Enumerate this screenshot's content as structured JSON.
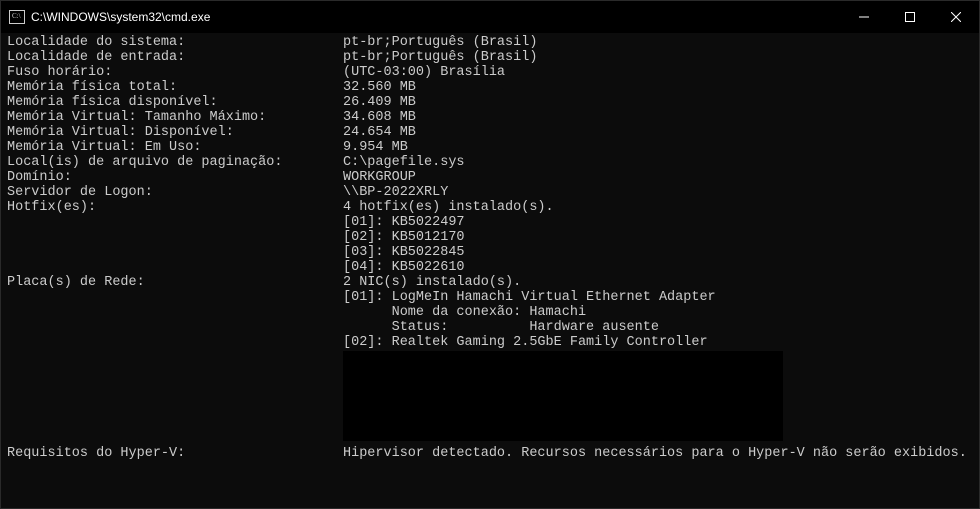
{
  "window": {
    "title": "C:\\WINDOWS\\system32\\cmd.exe"
  },
  "rows": [
    {
      "label": "Localidade do sistema:",
      "value": "pt-br;Português (Brasil)"
    },
    {
      "label": "Localidade de entrada:",
      "value": "pt-br;Português (Brasil)"
    },
    {
      "label": "Fuso horário:",
      "value": "(UTC-03:00) Brasília"
    },
    {
      "label": "Memória física total:",
      "value": "32.560 MB"
    },
    {
      "label": "Memória física disponível:",
      "value": "26.409 MB"
    },
    {
      "label": "Memória Virtual: Tamanho Máximo:",
      "value": "34.608 MB"
    },
    {
      "label": "Memória Virtual: Disponível:",
      "value": "24.654 MB"
    },
    {
      "label": "Memória Virtual: Em Uso:",
      "value": "9.954 MB"
    },
    {
      "label": "Local(is) de arquivo de paginação:",
      "value": "C:\\pagefile.sys"
    },
    {
      "label": "Domínio:",
      "value": "WORKGROUP"
    },
    {
      "label": "Servidor de Logon:",
      "value": "\\\\BP-2022XRLY"
    }
  ],
  "hotfixes": {
    "label": "Hotfix(es):",
    "summary": "4 hotfix(es) instalado(s).",
    "items": [
      "[01]: KB5022497",
      "[02]: KB5012170",
      "[03]: KB5022845",
      "[04]: KB5022610"
    ]
  },
  "nics": {
    "label": "Placa(s) de Rede:",
    "summary": "2 NIC(s) instalado(s).",
    "items": [
      "[01]: LogMeIn Hamachi Virtual Ethernet Adapter",
      "      Nome da conexão: Hamachi",
      "      Status:          Hardware ausente",
      "[02]: Realtek Gaming 2.5GbE Family Controller"
    ]
  },
  "hyperv": {
    "label": "Requisitos do Hyper-V:",
    "value": "Hipervisor detectado. Recursos necessários para o Hyper-V não serão exibidos."
  }
}
